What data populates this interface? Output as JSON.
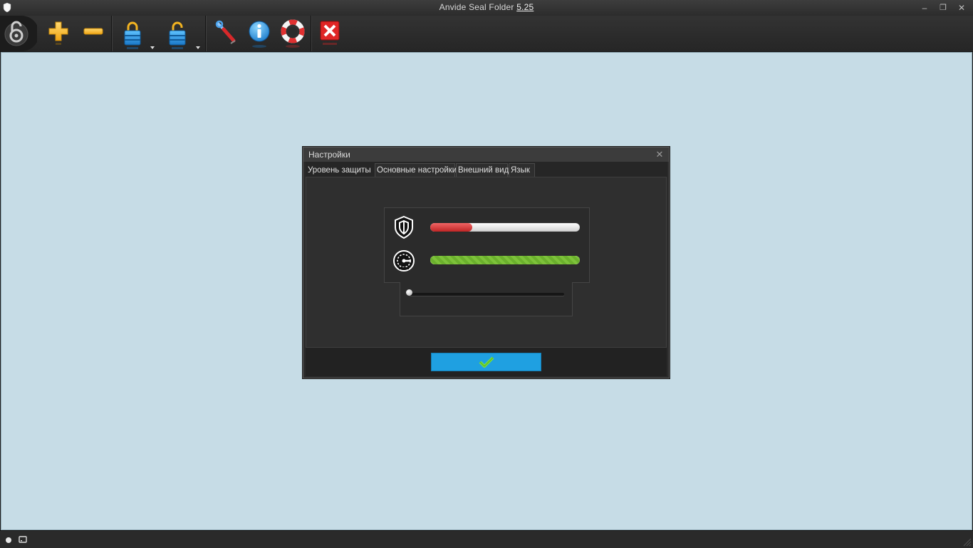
{
  "window": {
    "title_prefix": "Anvide Seal Folder",
    "version": "5.25",
    "minimize_glyph": "–",
    "restore_glyph": "❐",
    "close_glyph": "✕"
  },
  "toolbar": {
    "buttons": [
      {
        "icon": "lock-open-icon",
        "action": "lock-status"
      },
      {
        "icon": "plus-icon",
        "action": "add-folder"
      },
      {
        "icon": "minus-icon",
        "action": "remove-folder"
      },
      {
        "icon": "lock-closed-icon",
        "action": "close-access",
        "has_menu": true
      },
      {
        "icon": "lock-unlocked-icon",
        "action": "open-access",
        "has_menu": true
      },
      {
        "icon": "wrench-icon",
        "action": "settings"
      },
      {
        "icon": "info-icon",
        "action": "about"
      },
      {
        "icon": "lifebuoy-icon",
        "action": "help"
      },
      {
        "icon": "exit-icon",
        "action": "exit"
      }
    ]
  },
  "dialog": {
    "title": "Настройки",
    "close_glyph": "✕",
    "tabs": [
      {
        "label": "Уровень защиты",
        "active": true
      },
      {
        "label": "Основные настройки",
        "active": false
      },
      {
        "label": "Внешний вид",
        "active": false
      },
      {
        "label": "Язык",
        "active": false
      }
    ],
    "security_level": 0.28,
    "speed_level": 1.0,
    "slider_position": 0.0,
    "colors": {
      "security_bar": "#d93a3a",
      "speed_bar": "#74b833",
      "ok_button": "#1fa0e1"
    }
  },
  "colors": {
    "workspace": "#c6dce6",
    "chrome": "#2b2b2b"
  }
}
